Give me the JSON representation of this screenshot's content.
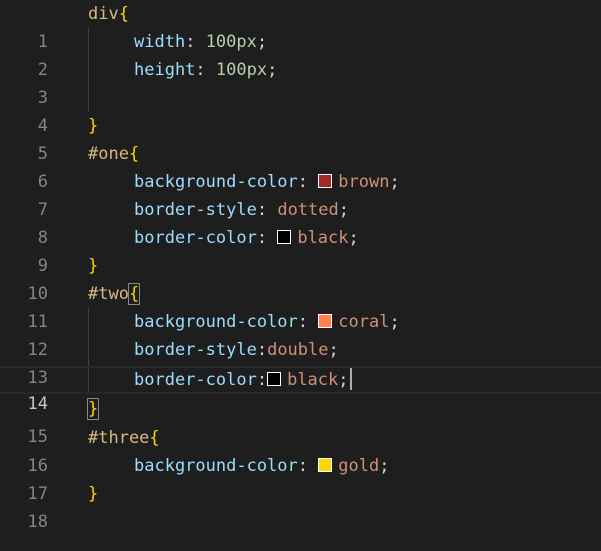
{
  "editor": {
    "lines": [
      {
        "num": "1",
        "selector": "div",
        "open": "{"
      },
      {
        "num": "2",
        "prop": "width",
        "colon": ":",
        "value": "100px",
        "semi": ";"
      },
      {
        "num": "3",
        "prop": "height",
        "colon": ":",
        "value": "100px",
        "semi": ";"
      },
      {
        "num": "4"
      },
      {
        "num": "5",
        "close": "}"
      },
      {
        "num": "6",
        "selector": "#one",
        "open": "{"
      },
      {
        "num": "7",
        "prop": "background-color",
        "colon": ":",
        "value": "brown",
        "semi": ";",
        "swatch": "#a52a2a"
      },
      {
        "num": "8",
        "prop": "border-style",
        "colon": ":",
        "value": "dotted",
        "semi": ";"
      },
      {
        "num": "9",
        "prop": "border-color",
        "colon": ":",
        "value": "black",
        "semi": ";",
        "swatch": "#000000"
      },
      {
        "num": "10",
        "close": "}"
      },
      {
        "num": "11",
        "selector": "#two",
        "open": "{"
      },
      {
        "num": "12",
        "prop": "background-color",
        "colon": ":",
        "value": "coral",
        "semi": ";",
        "swatch": "#ff7f50"
      },
      {
        "num": "13",
        "prop": "border-style",
        "colon": ":",
        "value": "double",
        "semi": ";"
      },
      {
        "num": "14",
        "prop": "border-color",
        "colon": ":",
        "value": "black",
        "semi": ";",
        "swatch": "#000000"
      },
      {
        "num": "15",
        "close": "}"
      },
      {
        "num": "16",
        "selector": "#three",
        "open": "{"
      },
      {
        "num": "17",
        "prop": "background-color",
        "colon": ":",
        "value": "gold",
        "semi": ";",
        "swatch": "#ffd700"
      },
      {
        "num": "18",
        "close": "}"
      }
    ],
    "current_line": "14",
    "colors": {
      "background": "#1e1e1e",
      "selector": "#d7ba7d",
      "brace": "#ffd700",
      "property": "#9cdcfe",
      "value": "#ce9178",
      "number": "#b5cea8",
      "line_number": "#858585"
    }
  }
}
